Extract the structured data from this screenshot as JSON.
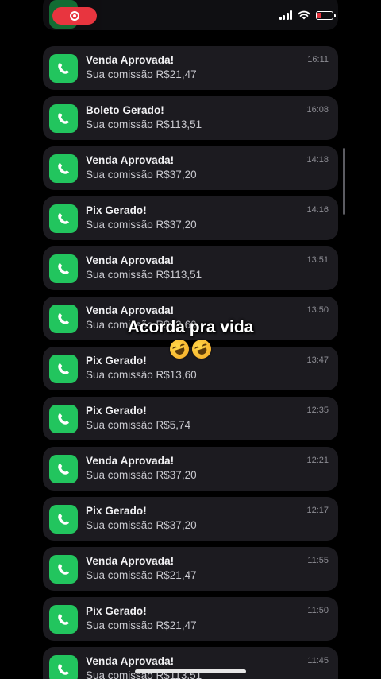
{
  "status_bar": {
    "recording_color": "#e8353f",
    "battery_level": 0.3,
    "battery_color": "#e8353f",
    "icons": [
      "screen-recording-icon",
      "cellular-signal-icon",
      "wifi-icon",
      "battery-icon"
    ]
  },
  "app_icon": "phone-handset-icon",
  "accent_color": "#22c55e",
  "notifications": [
    {
      "title": "Venda Aprovada!",
      "body": "Sua comissão R$21,47",
      "time": "16:11"
    },
    {
      "title": "Boleto Gerado!",
      "body": "Sua comissão R$113,51",
      "time": "16:08"
    },
    {
      "title": "Venda Aprovada!",
      "body": "Sua comissão R$37,20",
      "time": "14:18"
    },
    {
      "title": "Pix Gerado!",
      "body": "Sua comissão R$37,20",
      "time": "14:16"
    },
    {
      "title": "Venda Aprovada!",
      "body": "Sua comissão R$113,51",
      "time": "13:51"
    },
    {
      "title": "Venda Aprovada!",
      "body": "Sua comissão R$13,60",
      "time": "13:50"
    },
    {
      "title": "Pix Gerado!",
      "body": "Sua comissão R$13,60",
      "time": "13:47"
    },
    {
      "title": "Pix Gerado!",
      "body": "Sua comissão R$5,74",
      "time": "12:35"
    },
    {
      "title": "Venda Aprovada!",
      "body": "Sua comissão R$37,20",
      "time": "12:21"
    },
    {
      "title": "Pix Gerado!",
      "body": "Sua comissão R$37,20",
      "time": "12:17"
    },
    {
      "title": "Venda Aprovada!",
      "body": "Sua comissão R$21,47",
      "time": "11:55"
    },
    {
      "title": "Pix Gerado!",
      "body": "Sua comissão R$21,47",
      "time": "11:50"
    },
    {
      "title": "Venda Aprovada!",
      "body": "Sua comissão R$113,51",
      "time": "11:45"
    }
  ],
  "caption": {
    "text": "Acorda pra vida",
    "emoji": [
      "rolling-on-floor-laughing-emoji",
      "rolling-on-floor-laughing-emoji"
    ]
  }
}
